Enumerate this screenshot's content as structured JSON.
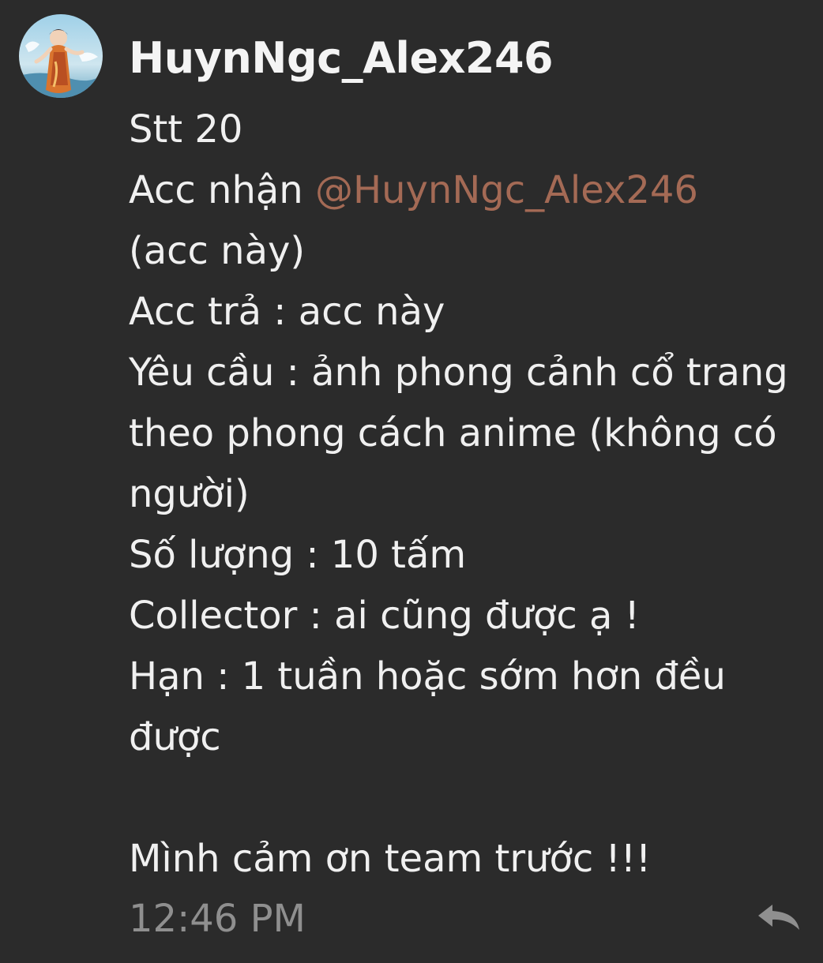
{
  "author": {
    "username": "HuynNgc_Alex246",
    "avatar_icon": "user-avatar"
  },
  "message": {
    "line1": "Stt 20",
    "line2_prefix": "Acc nhận ",
    "line2_mention": "@HuynNgc_Alex246",
    "line3": "(acc này)",
    "line4": "Acc trả : acc này",
    "line5": "Yêu cầu : ảnh phong cảnh cổ trang",
    "line6": "theo phong cách anime (không có",
    "line7": "người)",
    "line8": "Số lượng : 10 tấm",
    "line9": "Collector : ai cũng được ạ !",
    "line10": "Hạn : 1 tuần hoặc sớm hơn đều",
    "line11": "được",
    "line13": "Mình cảm ơn team trước !!!"
  },
  "timestamp": "12:46 PM",
  "colors": {
    "background": "#2b2b2b",
    "text": "#f0f0f0",
    "mention": "#a46a55",
    "timestamp": "#8f8f8f"
  },
  "actions": {
    "reply_icon": "reply-icon"
  }
}
